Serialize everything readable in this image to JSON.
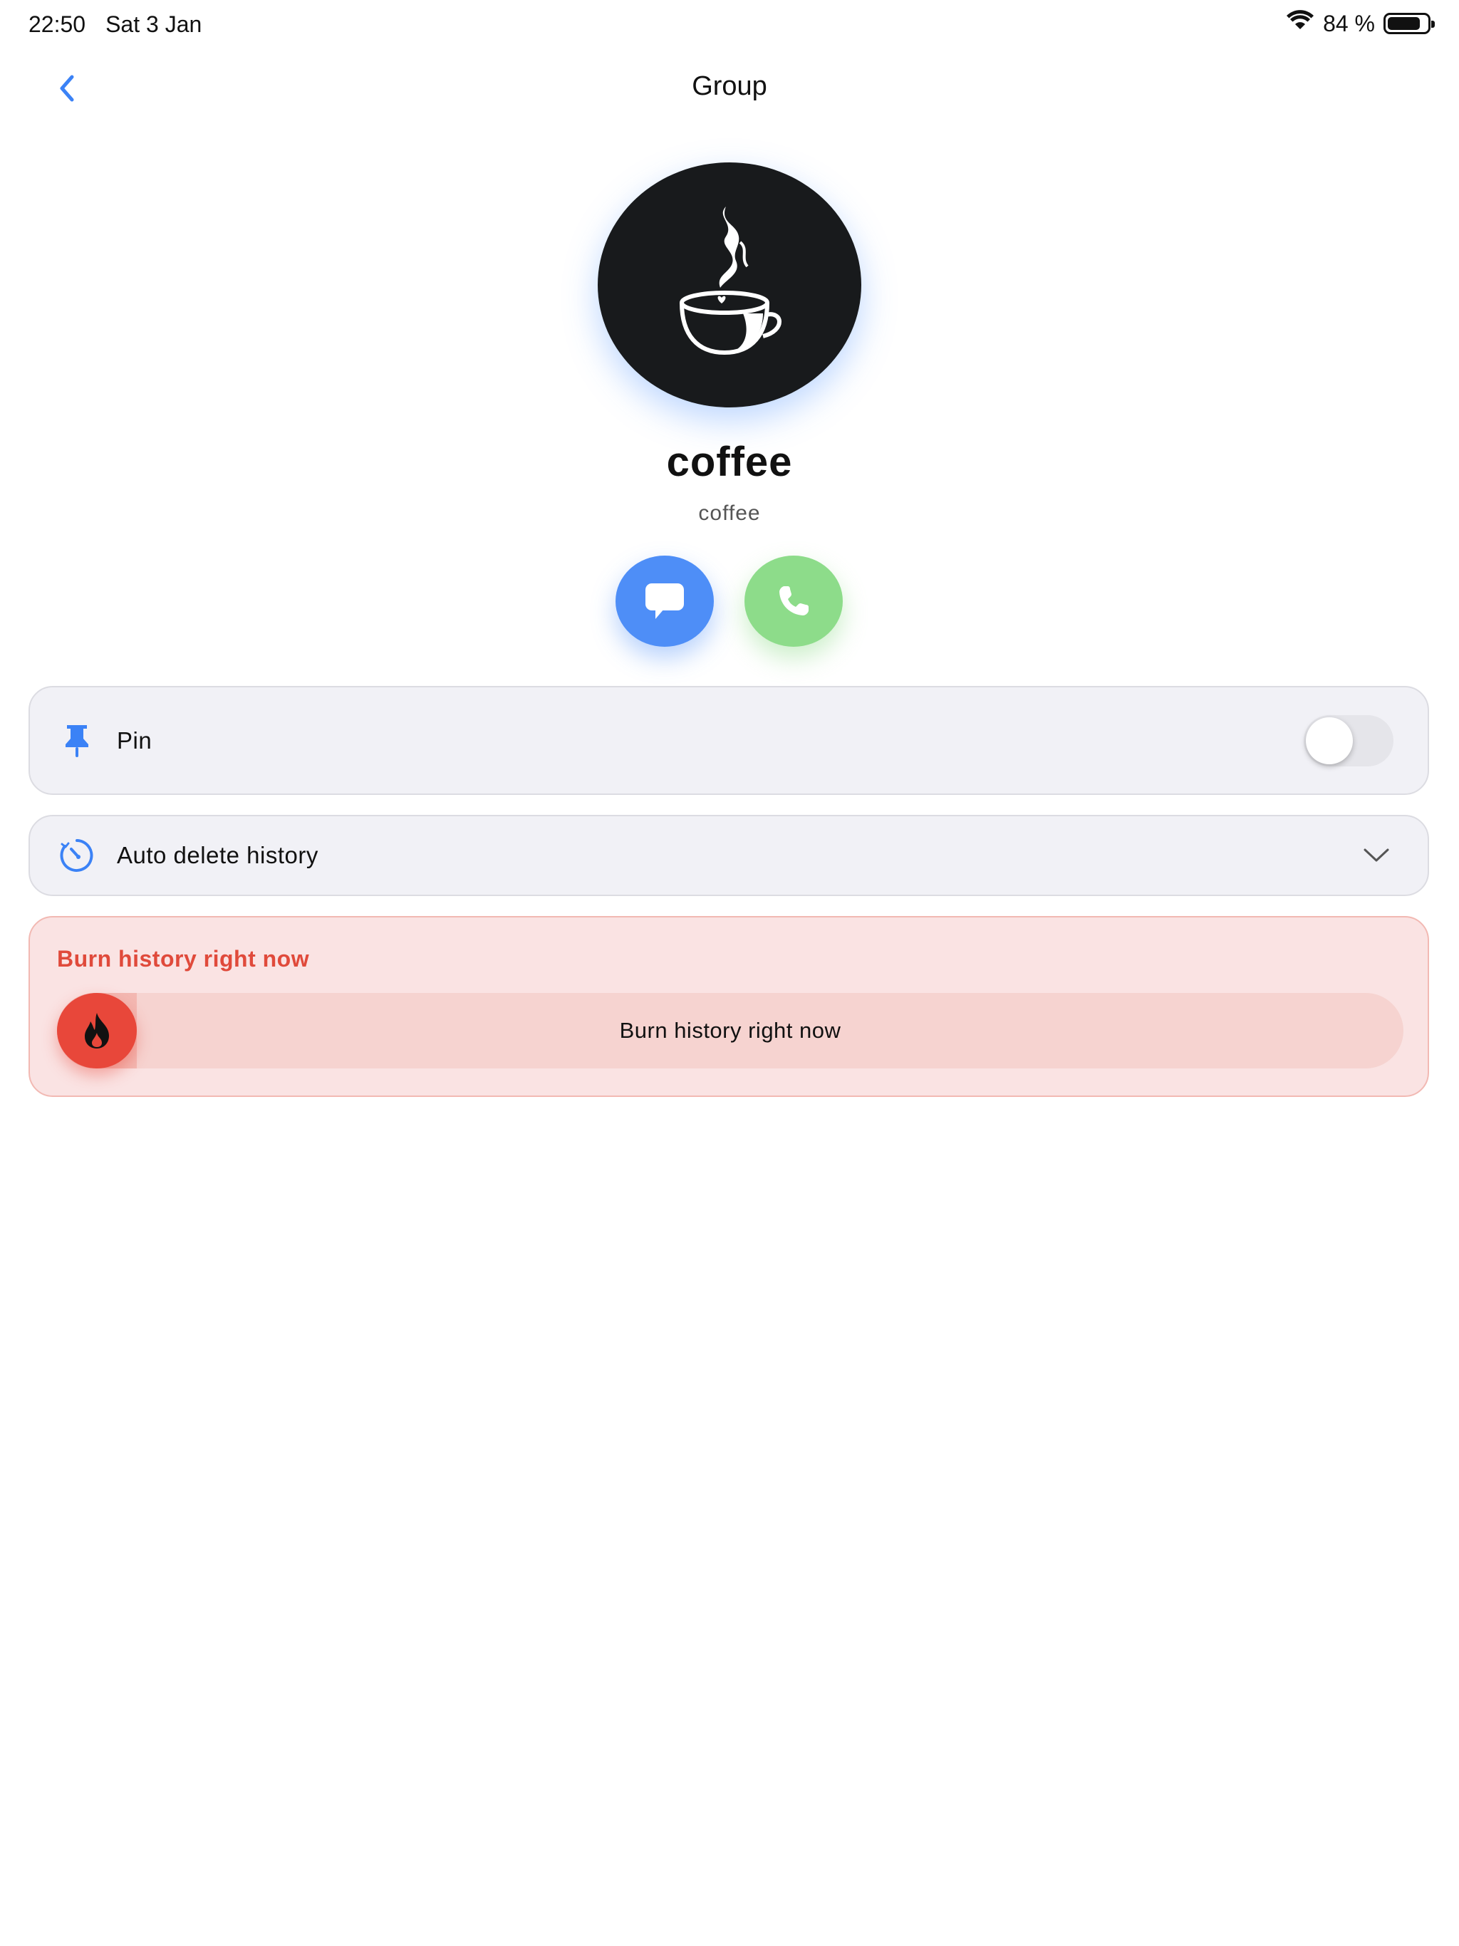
{
  "status_bar": {
    "time": "22:50",
    "date": "Sat 3 Jan",
    "battery_label": "84 %",
    "battery_level": 0.84
  },
  "nav": {
    "title": "Group"
  },
  "group": {
    "name": "coffee",
    "subtitle": "coffee"
  },
  "rows": {
    "pin": {
      "label": "Pin",
      "enabled": false
    },
    "auto_delete": {
      "label": "Auto delete history"
    }
  },
  "burn": {
    "title": "Burn history right now",
    "slider_label": "Burn history right now"
  },
  "colors": {
    "accent": "#4e8ef7",
    "call": "#8ddc8a",
    "danger": "#e8473a",
    "danger_text": "#e04a3b"
  },
  "icons": {
    "back": "chevron-left-icon",
    "chat": "chat-bubble-icon",
    "call": "phone-icon",
    "pin": "pin-icon",
    "timer": "timer-icon",
    "expand": "chevron-down-icon",
    "burn": "flame-icon",
    "avatar": "coffee-cup-icon",
    "wifi": "wifi-icon",
    "battery": "battery-icon"
  }
}
